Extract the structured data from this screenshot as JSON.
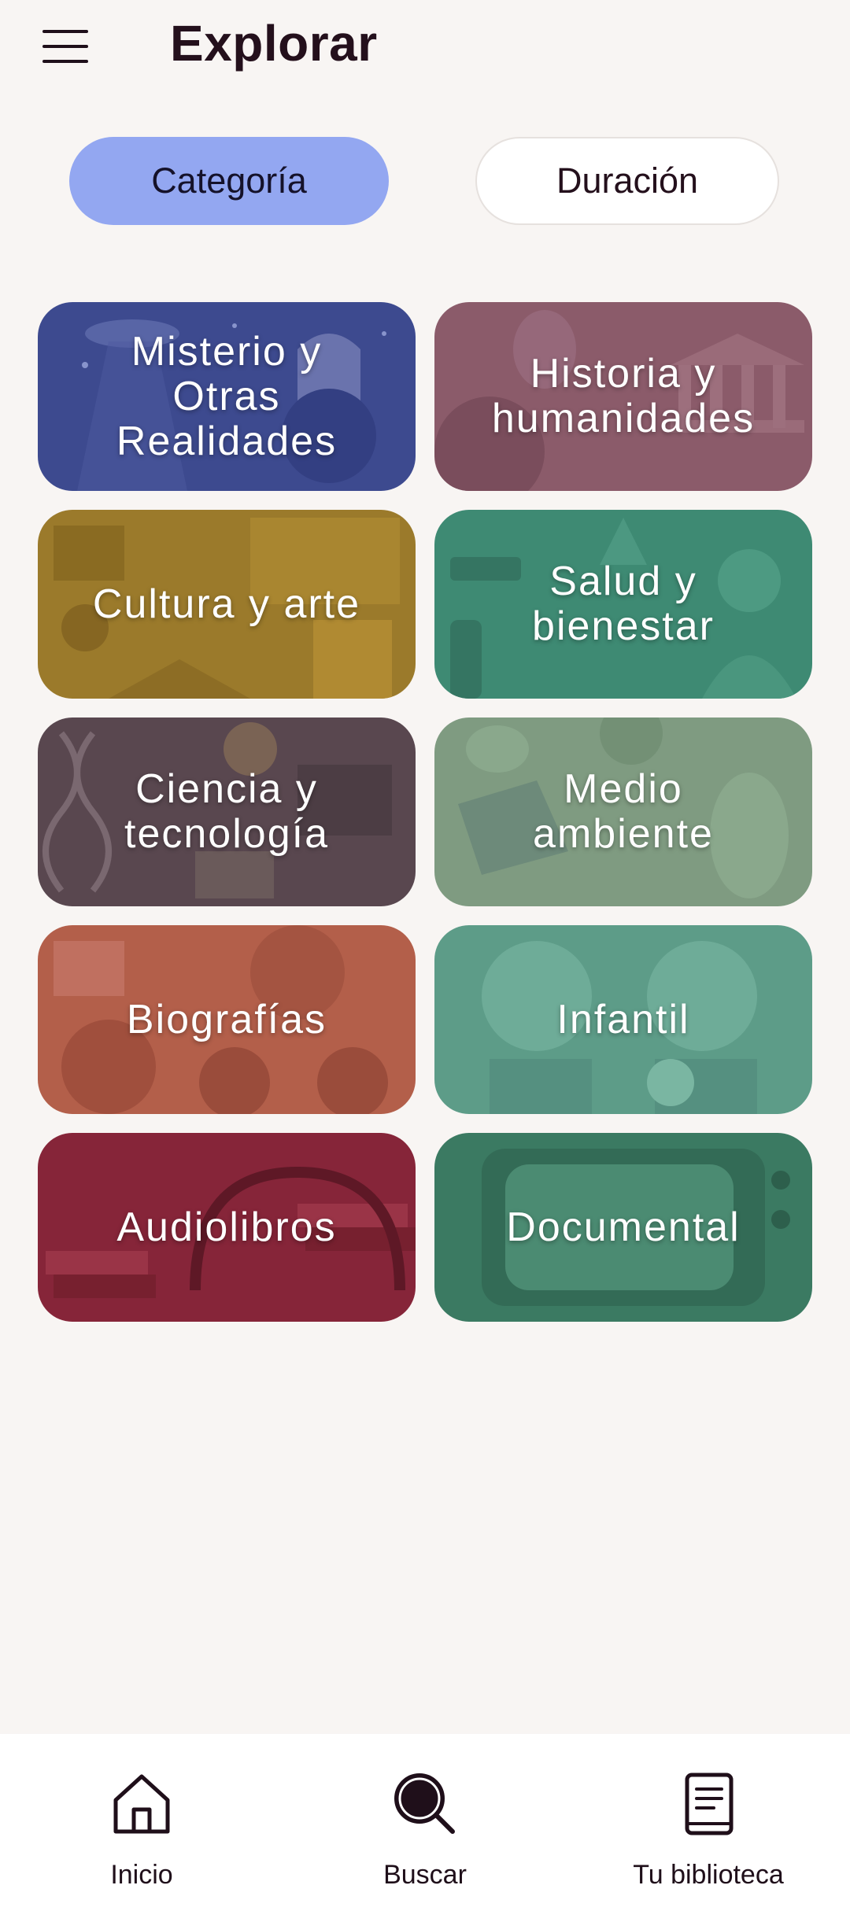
{
  "header": {
    "title": "Explorar",
    "menu_icon": "hamburger-menu-icon"
  },
  "filters": {
    "tabs": [
      {
        "label": "Categoría",
        "selected": true
      },
      {
        "label": "Duración",
        "selected": false
      }
    ],
    "active_color": "#93a7f1"
  },
  "categories": [
    {
      "label": "Misterio y\nOtras\nRealidades",
      "color": "#3e4a8e",
      "illustration": "ufo-ghost-mystery"
    },
    {
      "label": "Historia y\nhumanidades",
      "color": "#8c5c6b",
      "illustration": "greek-temple-statue"
    },
    {
      "label": "Cultura y arte",
      "color": "#9a7a2c",
      "illustration": "art-culture-popcorn"
    },
    {
      "label": "Salud y\nbienestar",
      "color": "#3e8a74",
      "illustration": "dumbbell-yoga"
    },
    {
      "label": "Ciencia y\ntecnología",
      "color": "#5a4852",
      "illustration": "dna-lightbulb-book"
    },
    {
      "label": "Medio\nambiente",
      "color": "#7f9a80",
      "illustration": "solar-panel-leaves"
    },
    {
      "label": "Biografías",
      "color": "#b45f4a",
      "illustration": "famous-portraits"
    },
    {
      "label": "Infantil",
      "color": "#5c9c89",
      "illustration": "kids-headphones"
    },
    {
      "label": "Audiolibros",
      "color": "#86263a",
      "illustration": "headphones-books"
    },
    {
      "label": "Documental",
      "color": "#3c7b63",
      "illustration": "retro-tv"
    }
  ],
  "bottom_nav": {
    "items": [
      {
        "label": "Inicio",
        "icon": "home-icon"
      },
      {
        "label": "Buscar",
        "icon": "search-icon",
        "active": true
      },
      {
        "label": "Tu biblioteca",
        "icon": "library-book-icon"
      }
    ]
  }
}
